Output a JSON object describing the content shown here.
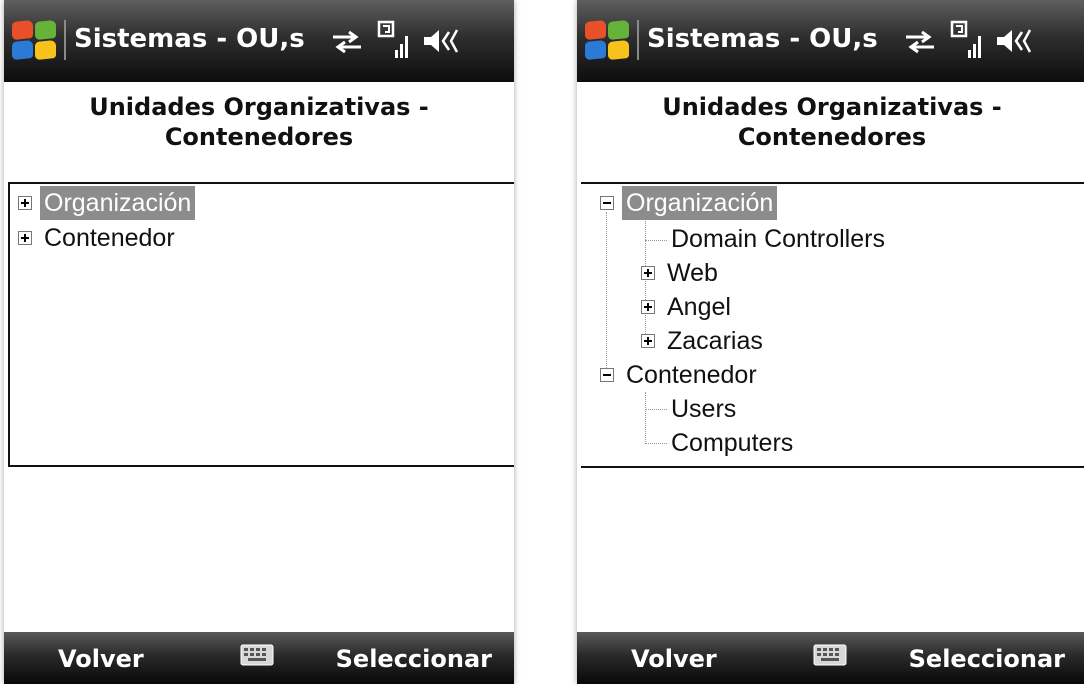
{
  "screens": [
    {
      "title_bar": {
        "app_title": "Sistemas - OU,s"
      },
      "header": {
        "line1": "Unidades Organizativas -",
        "line2": "Contenedores"
      },
      "tree": {
        "items": [
          {
            "label": "Organización",
            "expander": "+",
            "selected": true
          },
          {
            "label": "Contenedor",
            "expander": "+",
            "selected": false
          }
        ]
      },
      "softkeys": {
        "left": "Volver",
        "right": "Seleccionar",
        "center_icon": "keyboard-icon"
      }
    },
    {
      "title_bar": {
        "app_title": "Sistemas - OU,s"
      },
      "header": {
        "line1": "Unidades Organizativas -",
        "line2": "Contenedores"
      },
      "tree": {
        "items": [
          {
            "label": "Organización",
            "expander": "-",
            "selected": true,
            "level": 0
          },
          {
            "label": "Domain Controllers",
            "expander": "",
            "level": 1
          },
          {
            "label": "Web",
            "expander": "+",
            "level": 1
          },
          {
            "label": "Angel",
            "expander": "+",
            "level": 1
          },
          {
            "label": "Zacarias",
            "expander": "+",
            "level": 1
          },
          {
            "label": "Contenedor",
            "expander": "-",
            "level": 0
          },
          {
            "label": "Users",
            "expander": "",
            "level": 1
          },
          {
            "label": "Computers",
            "expander": "",
            "level": 1
          }
        ]
      },
      "softkeys": {
        "left": "Volver",
        "right": "Seleccionar",
        "center_icon": "keyboard-icon"
      }
    }
  ],
  "status_icons": [
    "start-icon",
    "data-sync-icon",
    "signal-icon",
    "speaker-icon"
  ],
  "colors": {
    "bar_dark": "#0d0d0d",
    "selection": "#8c8c8c"
  }
}
